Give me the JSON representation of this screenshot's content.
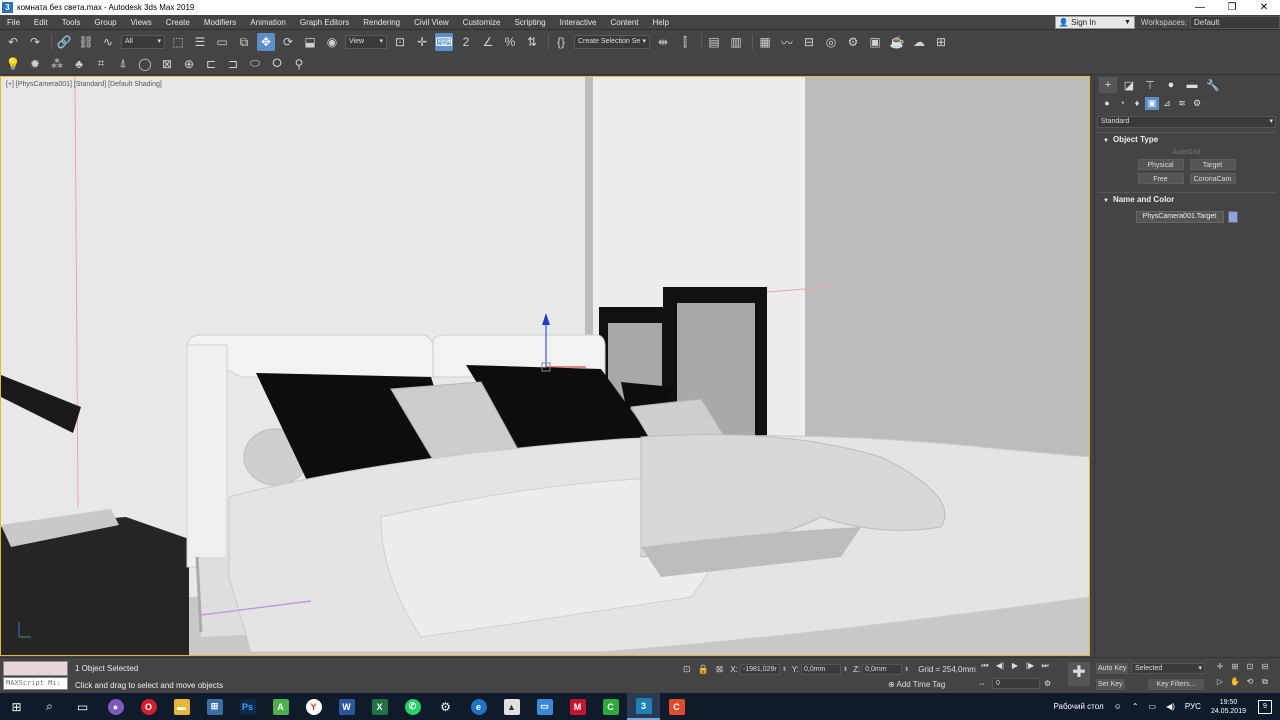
{
  "titlebar": {
    "title": "комната без света.max - Autodesk 3ds Max 2019",
    "app_icon": "3",
    "minimize": "—",
    "restore": "❐",
    "close": "✕"
  },
  "menu": {
    "items": [
      "File",
      "Edit",
      "Tools",
      "Group",
      "Views",
      "Create",
      "Modifiers",
      "Animation",
      "Graph Editors",
      "Rendering",
      "Civil View",
      "Customize",
      "Scripting",
      "Interactive",
      "Content",
      "Help"
    ],
    "sign_in": "Sign In",
    "workspaces_label": "Workspaces:",
    "workspace_value": "Default"
  },
  "toolbar": {
    "filter_value": "All",
    "coord_value": "View",
    "selection_set": "Create Selection Se"
  },
  "viewport": {
    "label": "[+] [PhysCamera001] [Standard] [Default Shading]"
  },
  "command_panel": {
    "category": "Standard",
    "object_type_title": "Object Type",
    "autogrid": "AutoGrid",
    "buttons": [
      "Physical",
      "Target",
      "Free",
      "CoronaCam"
    ],
    "name_color_title": "Name and Color",
    "object_name": "PhysCamera001.Target",
    "swatch_color": "#8fa2e6"
  },
  "status": {
    "maxscript": "MAXScript Mi:",
    "selection": "1 Object Selected",
    "prompt": "Click and drag to select and move objects",
    "x_label": "X:",
    "x_value": "-1981,029r",
    "y_label": "Y:",
    "y_value": "0,0mm",
    "z_label": "Z:",
    "z_value": "0,0mm",
    "grid": "Grid = 254,0mm",
    "add_time_tag": "Add Time Tag",
    "frame": "0",
    "auto_key": "Auto Key",
    "set_key": "Set Key",
    "selected": "Selected",
    "key_filters": "Key Filters..."
  },
  "taskbar": {
    "desktop_label": "Рабочий стол",
    "lang": "РУС",
    "time": "19:50",
    "date": "24.05.2019",
    "notifications": "9"
  }
}
